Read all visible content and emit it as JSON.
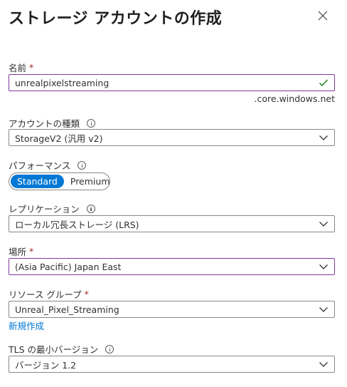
{
  "header": {
    "title": "ストレージ アカウントの作成",
    "more_label": "···"
  },
  "name": {
    "label": "名前",
    "required": "*",
    "value": "unrealpixelstreaming",
    "suffix": ".core.windows.net"
  },
  "account_kind": {
    "label": "アカウントの種類",
    "value": "StorageV2 (汎用 v2)"
  },
  "performance": {
    "label": "パフォーマンス",
    "options": [
      "Standard",
      "Premium"
    ],
    "selected": "Standard"
  },
  "replication": {
    "label": "レプリケーション",
    "value": "ローカル冗長ストレージ (LRS)"
  },
  "location": {
    "label": "場所",
    "required": "*",
    "value": "(Asia Pacific) Japan East"
  },
  "resource_group": {
    "label": "リソース グループ",
    "required": "*",
    "value": "Unreal_Pixel_Streaming",
    "create_new": "新規作成"
  },
  "tls": {
    "label": "TLS の最小バージョン",
    "value": "バージョン 1.2"
  },
  "colors": {
    "accent": "#0078d4",
    "focus_border": "#7d3a96",
    "required": "#a4262c",
    "valid": "#107c10"
  }
}
